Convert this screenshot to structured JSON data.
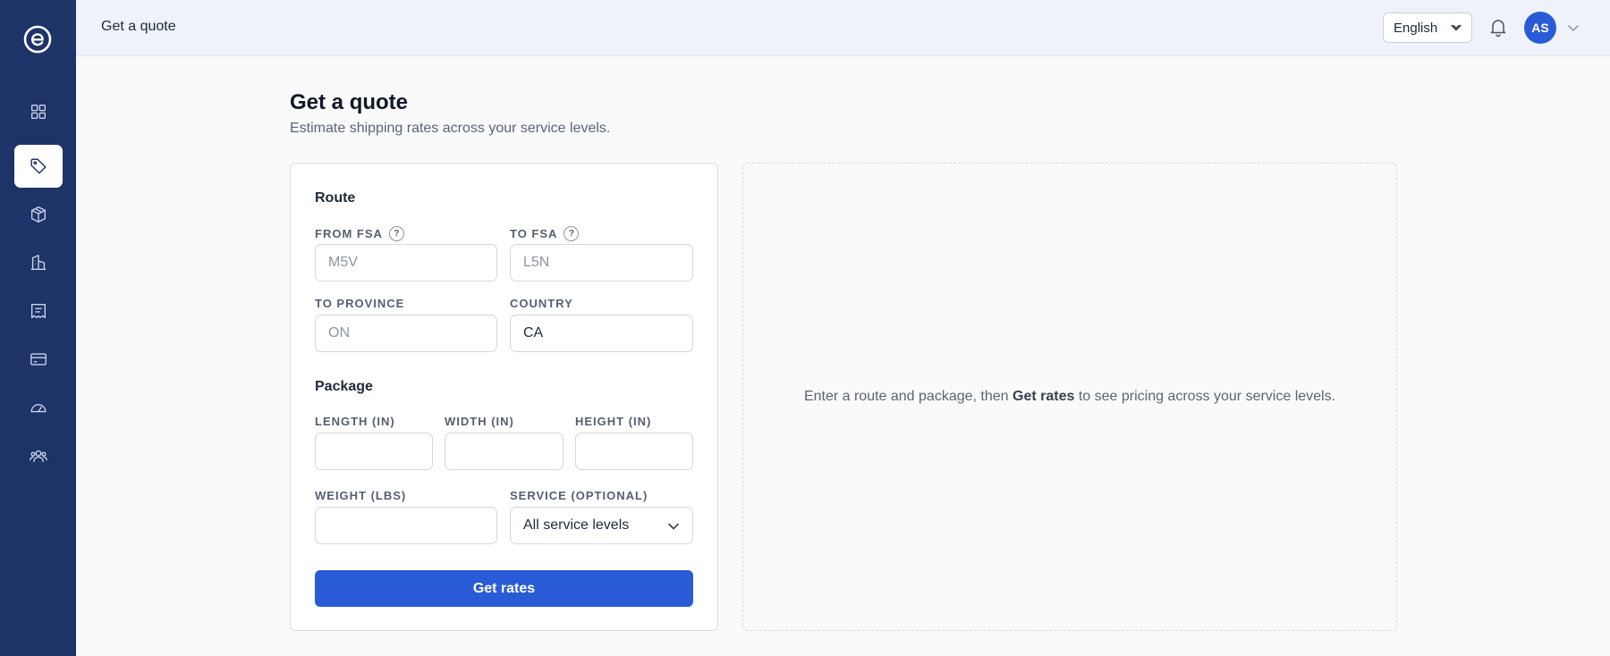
{
  "app": {
    "logo_icon": "e-circle-logo"
  },
  "sidebar": {
    "items": [
      {
        "id": "dashboard",
        "icon": "grid-icon",
        "active": false
      },
      {
        "id": "quote",
        "icon": "tag-icon",
        "active": true
      },
      {
        "id": "shipments",
        "icon": "box-icon",
        "active": false
      },
      {
        "id": "locations",
        "icon": "building-icon",
        "active": false
      },
      {
        "id": "invoices",
        "icon": "receipt-icon",
        "active": false
      },
      {
        "id": "billing",
        "icon": "card-icon",
        "active": false
      },
      {
        "id": "performance",
        "icon": "gauge-icon",
        "active": false
      },
      {
        "id": "team",
        "icon": "users-icon",
        "active": false
      }
    ]
  },
  "header": {
    "title": "Get a quote",
    "language": "English",
    "avatar_initials": "AS"
  },
  "page": {
    "title": "Get a quote",
    "subtitle": "Estimate shipping rates across your service levels."
  },
  "form": {
    "route_title": "Route",
    "from_fsa": {
      "label": "FROM FSA",
      "placeholder": "M5V",
      "value": ""
    },
    "to_fsa": {
      "label": "TO FSA",
      "placeholder": "L5N",
      "value": ""
    },
    "to_province": {
      "label": "TO PROVINCE",
      "placeholder": "ON",
      "value": ""
    },
    "country": {
      "label": "COUNTRY",
      "placeholder": "",
      "value": "CA"
    },
    "package_title": "Package",
    "length": {
      "label": "LENGTH (IN)",
      "value": ""
    },
    "width": {
      "label": "WIDTH (IN)",
      "value": ""
    },
    "height": {
      "label": "HEIGHT (IN)",
      "value": ""
    },
    "weight": {
      "label": "WEIGHT (LBS)",
      "value": ""
    },
    "service": {
      "label": "SERVICE (OPTIONAL)",
      "selected": "All service levels"
    },
    "help_glyph": "?",
    "submit_label": "Get rates"
  },
  "results": {
    "empty_prefix": "Enter a route and package, then ",
    "empty_emphasis": "Get rates",
    "empty_suffix": " to see pricing across your service levels."
  },
  "colors": {
    "sidebar_bg": "#1e3368",
    "topbar_bg": "#eff3f9",
    "accent": "#2a5bd7",
    "page_bg": "#fafafa"
  }
}
